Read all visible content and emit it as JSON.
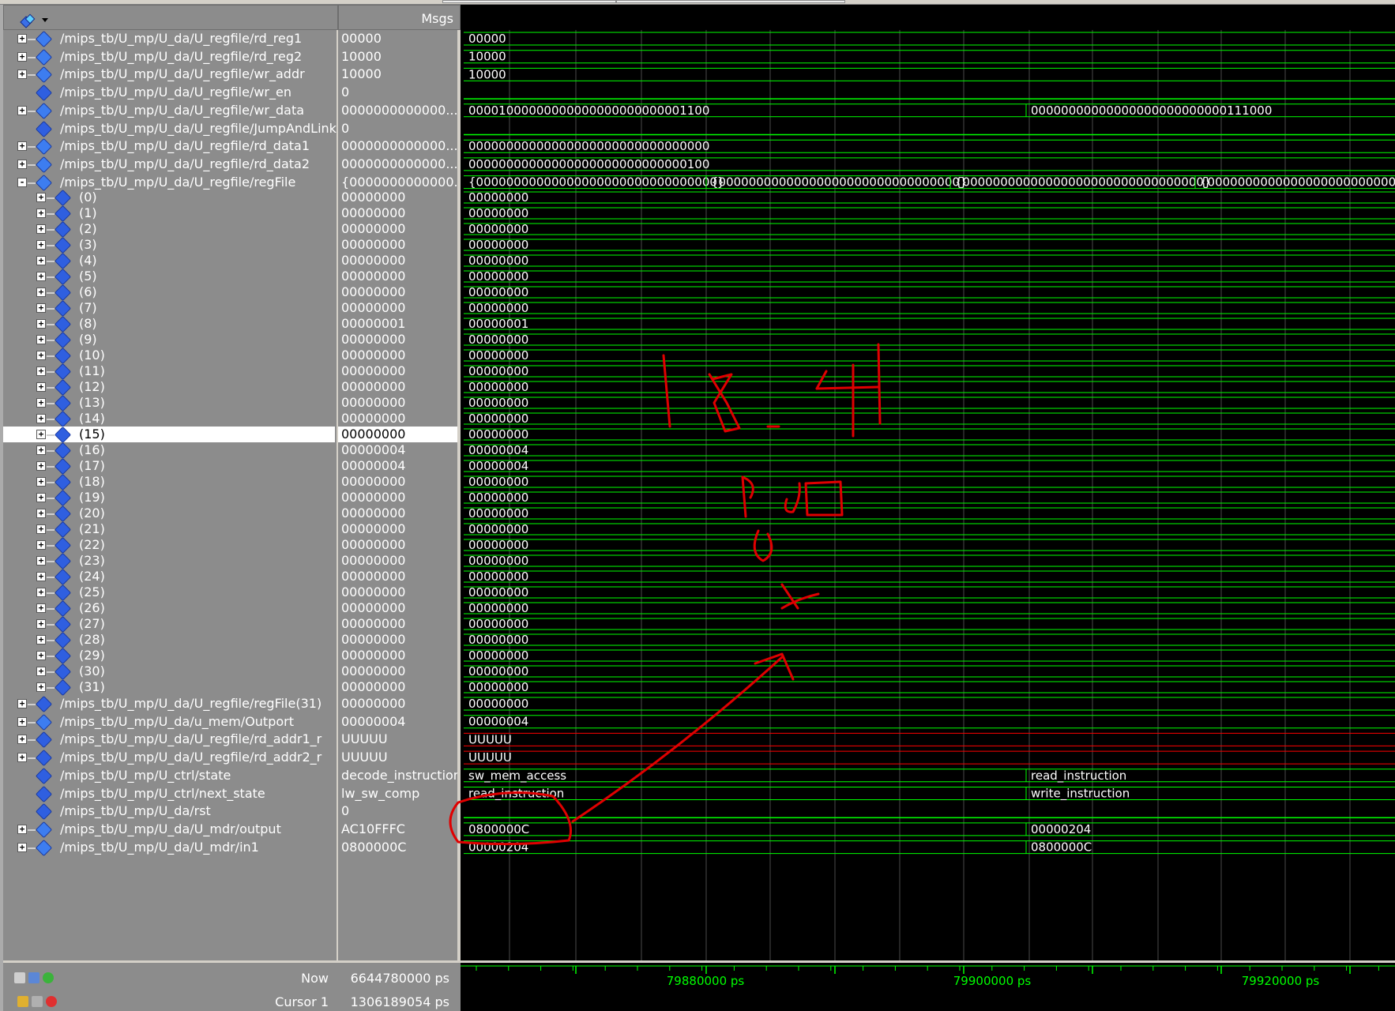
{
  "header": {
    "msgs_label": "Msgs"
  },
  "signals": [
    {
      "name": "/mips_tb/U_mp/U_da/U_regfile/rd_reg1",
      "value": "00000",
      "expand": "+",
      "icon": "bus-icon"
    },
    {
      "name": "/mips_tb/U_mp/U_da/U_regfile/rd_reg2",
      "value": "10000",
      "expand": "+",
      "icon": "bus-icon"
    },
    {
      "name": "/mips_tb/U_mp/U_da/U_regfile/wr_addr",
      "value": "10000",
      "expand": "+",
      "icon": "bus-icon"
    },
    {
      "name": "/mips_tb/U_mp/U_da/U_regfile/wr_en",
      "value": "0",
      "expand": "",
      "icon": "signal-icon"
    },
    {
      "name": "/mips_tb/U_mp/U_da/U_regfile/wr_data",
      "value": "0000000000000...",
      "expand": "+",
      "icon": "bus-icon"
    },
    {
      "name": "/mips_tb/U_mp/U_da/U_regfile/JumpAndLink",
      "value": "0",
      "expand": "",
      "icon": "signal-icon"
    },
    {
      "name": "/mips_tb/U_mp/U_da/U_regfile/rd_data1",
      "value": "0000000000000...",
      "expand": "+",
      "icon": "bus-icon"
    },
    {
      "name": "/mips_tb/U_mp/U_da/U_regfile/rd_data2",
      "value": "0000000000000...",
      "expand": "+",
      "icon": "bus-icon"
    },
    {
      "name": "/mips_tb/U_mp/U_da/U_regfile/regFile",
      "value": "{0000000000000...",
      "expand": "-",
      "icon": "bus-icon"
    },
    {
      "name": "(0)",
      "value": "00000000",
      "expand": "+",
      "icon": "diamond-icon",
      "child": true
    },
    {
      "name": "(1)",
      "value": "00000000",
      "expand": "+",
      "icon": "diamond-icon",
      "child": true
    },
    {
      "name": "(2)",
      "value": "00000000",
      "expand": "+",
      "icon": "diamond-icon",
      "child": true
    },
    {
      "name": "(3)",
      "value": "00000000",
      "expand": "+",
      "icon": "diamond-icon",
      "child": true
    },
    {
      "name": "(4)",
      "value": "00000000",
      "expand": "+",
      "icon": "diamond-icon",
      "child": true
    },
    {
      "name": "(5)",
      "value": "00000000",
      "expand": "+",
      "icon": "diamond-icon",
      "child": true
    },
    {
      "name": "(6)",
      "value": "00000000",
      "expand": "+",
      "icon": "diamond-icon",
      "child": true
    },
    {
      "name": "(7)",
      "value": "00000000",
      "expand": "+",
      "icon": "diamond-icon",
      "child": true
    },
    {
      "name": "(8)",
      "value": "00000001",
      "expand": "+",
      "icon": "diamond-icon",
      "child": true
    },
    {
      "name": "(9)",
      "value": "00000000",
      "expand": "+",
      "icon": "diamond-icon",
      "child": true
    },
    {
      "name": "(10)",
      "value": "00000000",
      "expand": "+",
      "icon": "diamond-icon",
      "child": true
    },
    {
      "name": "(11)",
      "value": "00000000",
      "expand": "+",
      "icon": "diamond-icon",
      "child": true
    },
    {
      "name": "(12)",
      "value": "00000000",
      "expand": "+",
      "icon": "diamond-icon",
      "child": true
    },
    {
      "name": "(13)",
      "value": "00000000",
      "expand": "+",
      "icon": "diamond-icon",
      "child": true
    },
    {
      "name": "(14)",
      "value": "00000000",
      "expand": "+",
      "icon": "diamond-icon",
      "child": true
    },
    {
      "name": "(15)",
      "value": "00000000",
      "expand": "+",
      "icon": "diamond-icon",
      "child": true,
      "selected": true
    },
    {
      "name": "(16)",
      "value": "00000004",
      "expand": "+",
      "icon": "diamond-icon",
      "child": true
    },
    {
      "name": "(17)",
      "value": "00000004",
      "expand": "+",
      "icon": "diamond-icon",
      "child": true
    },
    {
      "name": "(18)",
      "value": "00000000",
      "expand": "+",
      "icon": "diamond-icon",
      "child": true
    },
    {
      "name": "(19)",
      "value": "00000000",
      "expand": "+",
      "icon": "diamond-icon",
      "child": true
    },
    {
      "name": "(20)",
      "value": "00000000",
      "expand": "+",
      "icon": "diamond-icon",
      "child": true
    },
    {
      "name": "(21)",
      "value": "00000000",
      "expand": "+",
      "icon": "diamond-icon",
      "child": true
    },
    {
      "name": "(22)",
      "value": "00000000",
      "expand": "+",
      "icon": "diamond-icon",
      "child": true
    },
    {
      "name": "(23)",
      "value": "00000000",
      "expand": "+",
      "icon": "diamond-icon",
      "child": true
    },
    {
      "name": "(24)",
      "value": "00000000",
      "expand": "+",
      "icon": "diamond-icon",
      "child": true
    },
    {
      "name": "(25)",
      "value": "00000000",
      "expand": "+",
      "icon": "diamond-icon",
      "child": true
    },
    {
      "name": "(26)",
      "value": "00000000",
      "expand": "+",
      "icon": "diamond-icon",
      "child": true
    },
    {
      "name": "(27)",
      "value": "00000000",
      "expand": "+",
      "icon": "diamond-icon",
      "child": true
    },
    {
      "name": "(28)",
      "value": "00000000",
      "expand": "+",
      "icon": "diamond-icon",
      "child": true
    },
    {
      "name": "(29)",
      "value": "00000000",
      "expand": "+",
      "icon": "diamond-icon",
      "child": true
    },
    {
      "name": "(30)",
      "value": "00000000",
      "expand": "+",
      "icon": "diamond-icon",
      "child": true
    },
    {
      "name": "(31)",
      "value": "00000000",
      "expand": "+",
      "icon": "diamond-icon",
      "child": true
    },
    {
      "name": "/mips_tb/U_mp/U_da/U_regfile/regFile(31)",
      "value": "00000000",
      "expand": "+",
      "icon": "diamond-icon"
    },
    {
      "name": "/mips_tb/U_mp/U_da/u_mem/Outport",
      "value": "00000004",
      "expand": "+",
      "icon": "bus-icon"
    },
    {
      "name": "/mips_tb/U_mp/U_da/U_regfile/rd_addr1_r",
      "value": "UUUUU",
      "expand": "+",
      "icon": "diamond-icon"
    },
    {
      "name": "/mips_tb/U_mp/U_da/U_regfile/rd_addr2_r",
      "value": "UUUUU",
      "expand": "+",
      "icon": "diamond-icon"
    },
    {
      "name": "/mips_tb/U_mp/U_ctrl/state",
      "value": "decode_instruction",
      "expand": "",
      "icon": "diamond-icon"
    },
    {
      "name": "/mips_tb/U_mp/U_ctrl/next_state",
      "value": "lw_sw_comp",
      "expand": "",
      "icon": "diamond-icon"
    },
    {
      "name": "/mips_tb/U_mp/U_da/rst",
      "value": "0",
      "expand": "",
      "icon": "signal-icon"
    },
    {
      "name": "/mips_tb/U_mp/U_da/U_mdr/output",
      "value": "AC10FFFC",
      "expand": "+",
      "icon": "bus-icon"
    },
    {
      "name": "/mips_tb/U_mp/U_da/U_mdr/in1",
      "value": "0800000C",
      "expand": "+",
      "icon": "bus-icon"
    }
  ],
  "waves": {
    "rd_reg1": [
      "00000"
    ],
    "rd_reg2": [
      "10000"
    ],
    "wr_addr": [
      "10000"
    ],
    "wr_data": [
      "00001000000000000000000000001100",
      "00000000000000000000000000111000"
    ],
    "rd_data1": [
      "00000000000000000000000000000000"
    ],
    "rd_data2": [
      "00000000000000000000000000000100"
    ],
    "regFile": [
      "{00000000000000000000000000000000}",
      "{00000000000000000000000000000000}",
      "{00000000000000000000000000000000}",
      "{0000000000000000000000000000"
    ],
    "regfile_items": [
      "00000000",
      "00000000",
      "00000000",
      "00000000",
      "00000000",
      "00000000",
      "00000000",
      "00000000",
      "00000001",
      "00000000",
      "00000000",
      "00000000",
      "00000000",
      "00000000",
      "00000000",
      "00000000",
      "00000004",
      "00000004",
      "00000000",
      "00000000",
      "00000000",
      "00000000",
      "00000000",
      "00000000",
      "00000000",
      "00000000",
      "00000000",
      "00000000",
      "00000000",
      "00000000",
      "00000000",
      "00000000"
    ],
    "regFile31": [
      "00000000"
    ],
    "outport": [
      "00000004"
    ],
    "rd_addr1_r": [
      "UUUUU"
    ],
    "rd_addr2_r": [
      "UUUUU"
    ],
    "state": [
      "sw_mem_access",
      "read_instruction"
    ],
    "next_state": [
      "read_instruction",
      "write_instruction"
    ],
    "mdr_output": [
      "0800000C",
      "00000204"
    ],
    "mdr_in1": [
      "00000204",
      "0800000C"
    ]
  },
  "footer": {
    "now_label": "Now",
    "now_value": "6644780000 ps",
    "cursor_label": "Cursor 1",
    "cursor_value": "1306189054 ps",
    "time_ticks": [
      "79880000 ps",
      "79900000 ps",
      "79920000 ps"
    ]
  },
  "colors": {
    "wave_green": "#00ff00",
    "grid": "#4a4a4a",
    "undefined_red": "#ff0000",
    "annotation_red": "#e00000"
  }
}
